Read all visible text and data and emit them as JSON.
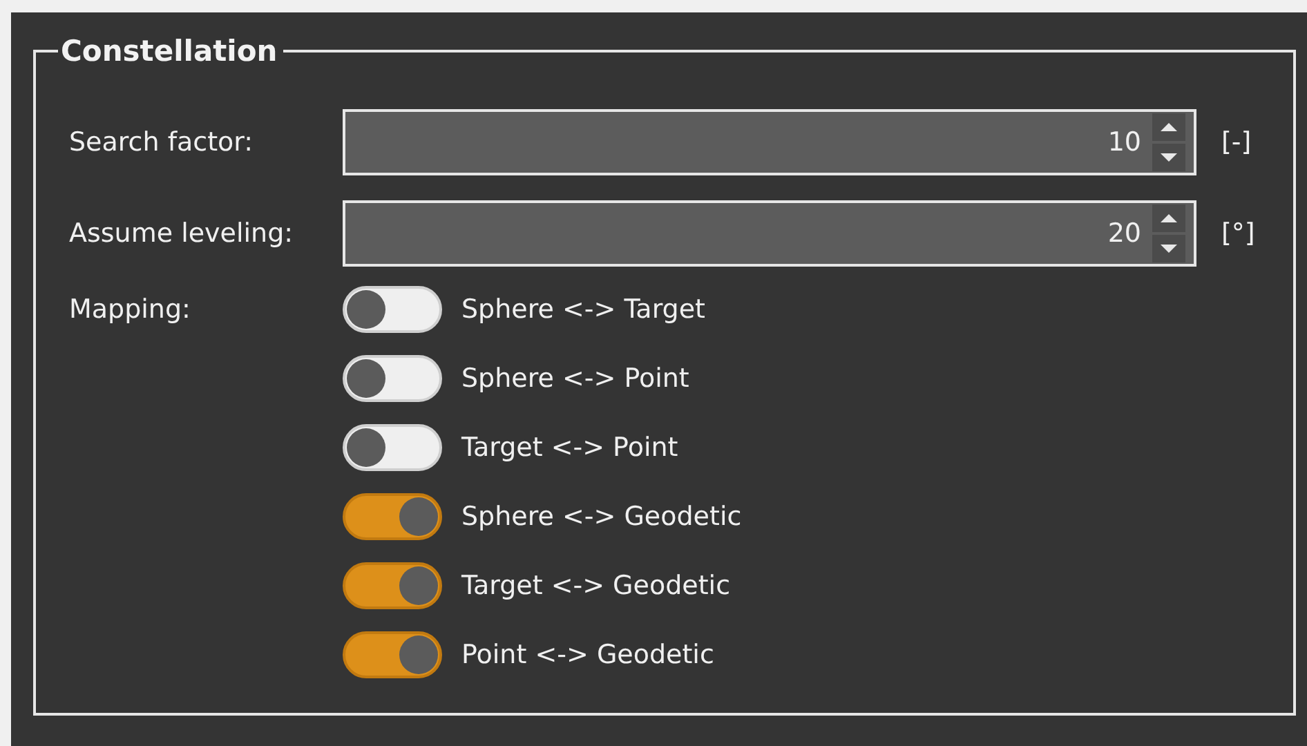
{
  "group": {
    "title": "Constellation"
  },
  "spinboxes": [
    {
      "label": "Search factor:",
      "value": "10",
      "unit": "[-]"
    },
    {
      "label": "Assume leveling:",
      "value": "20",
      "unit": "[°]"
    }
  ],
  "mapping": {
    "label": "Mapping:",
    "toggles": [
      {
        "label": "Sphere <-> Target",
        "on": false
      },
      {
        "label": "Sphere <-> Point",
        "on": false
      },
      {
        "label": "Target <-> Point",
        "on": false
      },
      {
        "label": "Sphere <-> Geodetic",
        "on": true
      },
      {
        "label": "Target <-> Geodetic",
        "on": true
      },
      {
        "label": "Point <-> Geodetic",
        "on": true
      }
    ]
  }
}
